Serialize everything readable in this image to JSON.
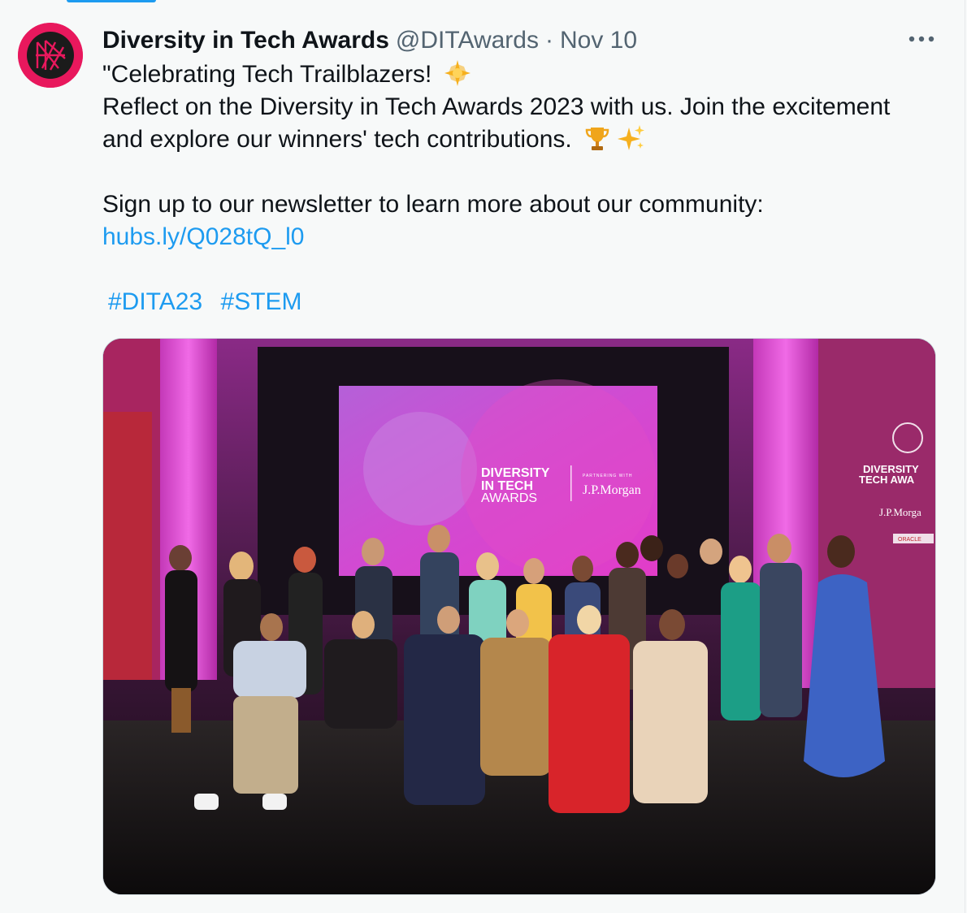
{
  "tweet": {
    "author": {
      "display_name": "Diversity in Tech Awards",
      "handle": "@DITAwards"
    },
    "separator": "·",
    "timestamp": "Nov 10",
    "more_icon": "more-horizontal-icon",
    "text": {
      "line1": "\"Celebrating Tech Trailblazers!",
      "line2": "Reflect on the Diversity in Tech Awards 2023 with us. Join the excitement",
      "line3": "and explore our winners' tech contributions.",
      "line5": "Sign up to our newsletter to learn more about our community:",
      "link": "hubs.ly/Q028tQ_l0"
    },
    "hashtags": [
      "#DITA23",
      "#STEM"
    ],
    "emojis": [
      "glowing-star-icon",
      "trophy-icon",
      "sparkles-icon"
    ],
    "media": {
      "screen_logo_line1": "DIVERSITY",
      "screen_logo_line2": "IN TECH",
      "screen_logo_line3": "AWARDS",
      "screen_partner_label": "PARTNERING WITH",
      "screen_partner": "J.P.Morgan",
      "banner_line1": "DIVERSITY",
      "banner_line2": "TECH AWA",
      "banner_partner": "J.P.Morga",
      "banner_sponsor": "ORACLE"
    }
  },
  "colors": {
    "accent": "#1d9bf0",
    "text_primary": "#0f1419",
    "text_secondary": "#536471",
    "brand_pink": "#e8185d",
    "background": "#f7f9f9"
  }
}
